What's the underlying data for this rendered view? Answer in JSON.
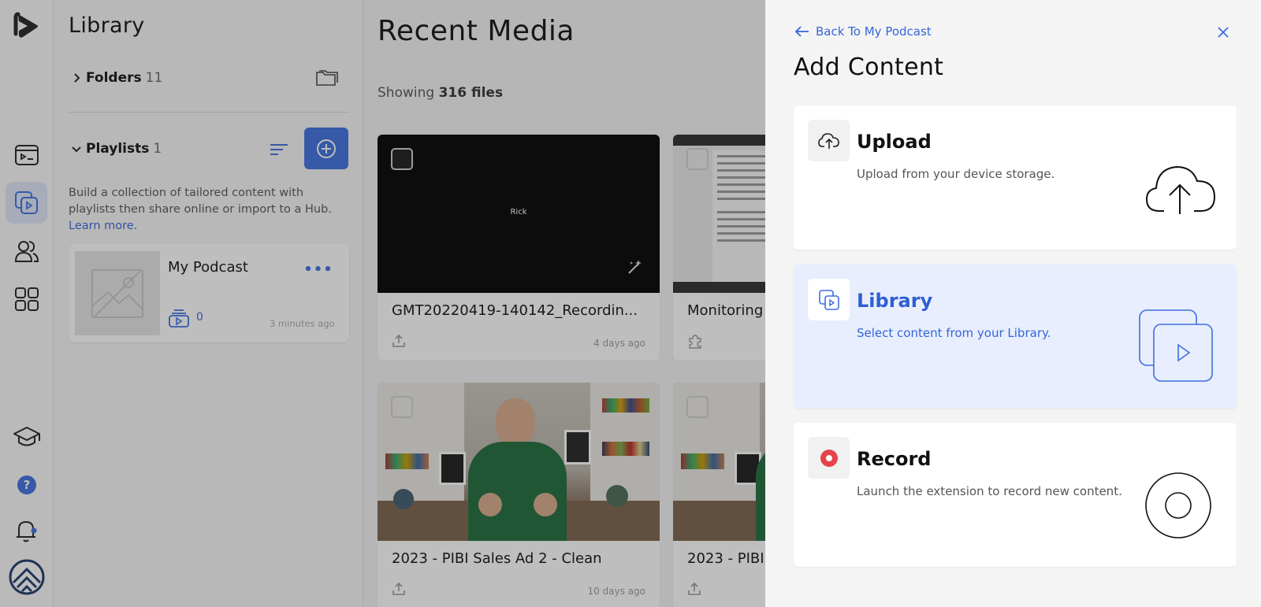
{
  "library": {
    "title": "Library",
    "folders": {
      "label": "Folders",
      "count": "11"
    },
    "playlists": {
      "label": "Playlists",
      "count": "1"
    },
    "description": "Build a collection of tailored content with playlists then share online or import to a Hub.",
    "learn_more": "Learn more.",
    "playlist_card": {
      "name": "My Podcast",
      "count": "0",
      "time": "3 minutes ago"
    }
  },
  "media": {
    "title": "Recent Media",
    "showing_prefix": "Showing",
    "showing_count": "316 files",
    "cards": [
      {
        "name": "GMT20220419-140142_Recordin...",
        "time": "4 days ago",
        "thumb_text": "Rick"
      },
      {
        "name": "Monitoring",
        "time": ""
      },
      {
        "name": "2023 - PIBI Sales Ad 2 - Clean",
        "time": "10 days ago"
      },
      {
        "name": "2023 - PIBI",
        "time": ""
      }
    ]
  },
  "drawer": {
    "back_label": "Back To My Podcast",
    "title": "Add Content",
    "options": [
      {
        "title": "Upload",
        "desc": "Upload from your device storage."
      },
      {
        "title": "Library",
        "desc": "Select content from your Library."
      },
      {
        "title": "Record",
        "desc": "Launch the extension to record new content."
      }
    ]
  },
  "colors": {
    "accent": "#3d6fe0",
    "accent_text": "#3565d8",
    "selected_bg": "#e8eefd",
    "record_red": "#e5434b"
  },
  "icons": [
    "logo-icon",
    "dashboard-icon",
    "library-icon",
    "users-icon",
    "apps-icon",
    "academy-icon",
    "help-icon",
    "notifications-icon",
    "account-avatar-icon"
  ]
}
